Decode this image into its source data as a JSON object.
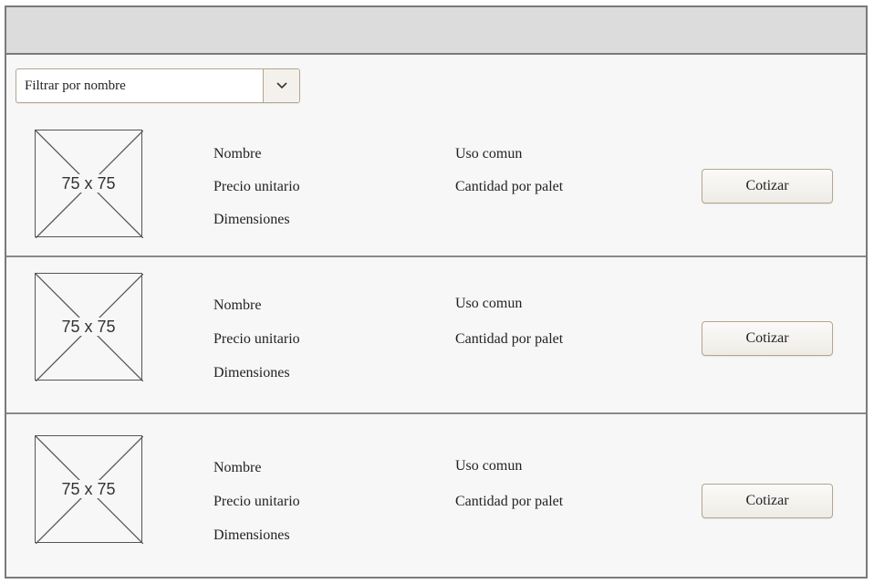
{
  "filter": {
    "label": "Filtrar por nombre",
    "icon": "chevron-down-icon"
  },
  "products": [
    {
      "image_label": "75 x 75",
      "fields": [
        "Nombre",
        "Precio unitario",
        "Dimensiones"
      ],
      "fields_right": [
        "Uso comun",
        "Cantidad por palet"
      ],
      "button": "Cotizar"
    },
    {
      "image_label": "75 x 75",
      "fields": [
        "Nombre",
        "Precio unitario",
        "Dimensiones"
      ],
      "fields_right": [
        "Uso comun",
        "Cantidad por palet"
      ],
      "button": "Cotizar"
    },
    {
      "image_label": "75 x 75",
      "fields": [
        "Nombre",
        "Precio unitario",
        "Dimensiones"
      ],
      "fields_right": [
        "Uso comun",
        "Cantidad por palet"
      ],
      "button": "Cotizar"
    }
  ],
  "colors": {
    "header_bg": "#dcdcdc",
    "border": "#7a7a7a",
    "button_border": "#b5a58e"
  }
}
